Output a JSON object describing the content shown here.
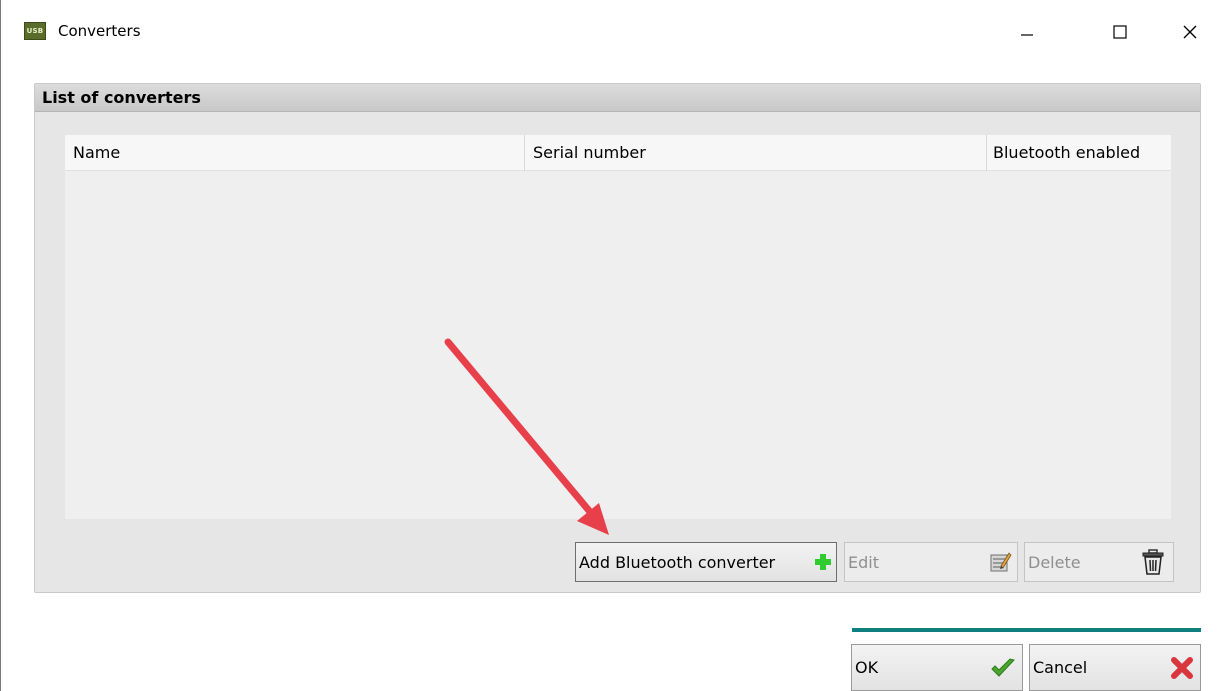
{
  "window": {
    "app_icon_text": "USB",
    "title": "Converters",
    "controls": {
      "minimize": "minimize-icon",
      "maximize": "maximize-icon",
      "close": "close-icon"
    }
  },
  "group": {
    "title": "List of converters"
  },
  "table": {
    "columns": [
      "Name",
      "Serial number",
      "Bluetooth enabled"
    ],
    "rows": []
  },
  "actions": {
    "add_label": "Add Bluetooth converter",
    "add_icon": "plus-icon",
    "add_icon_color": "#2ecc2e",
    "edit_label": "Edit",
    "edit_icon": "edit-icon",
    "edit_enabled": false,
    "delete_label": "Delete",
    "delete_icon": "trash-icon",
    "delete_enabled": false
  },
  "footer": {
    "ok_label": "OK",
    "ok_icon": "checkmark-icon",
    "ok_icon_color": "#4aa62e",
    "cancel_label": "Cancel",
    "cancel_icon": "x-mark-icon",
    "cancel_icon_color": "#d9363e",
    "accent_color": "#0f7f7f"
  },
  "annotation": {
    "arrow_color": "#e8404a",
    "points_to": "add-bluetooth-converter-button"
  }
}
